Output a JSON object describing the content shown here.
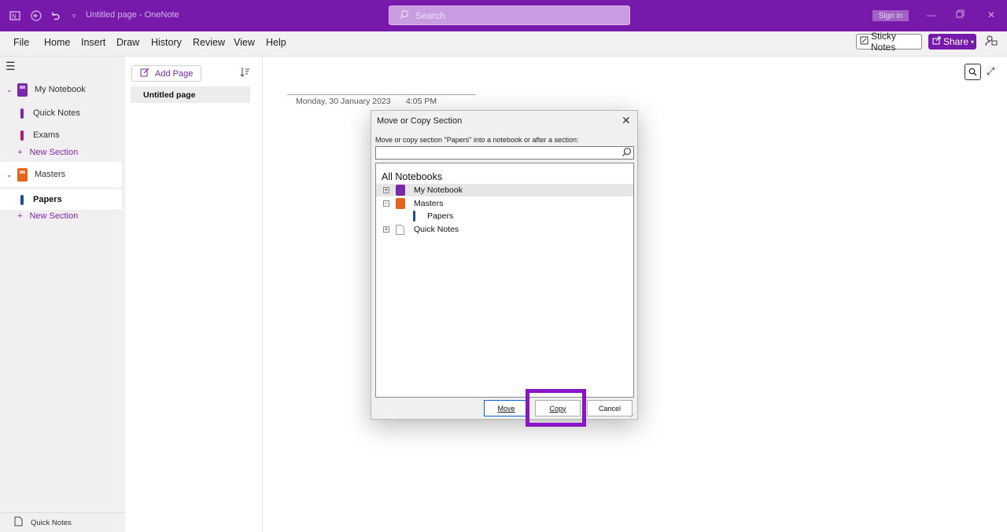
{
  "titlebar": {
    "title": "Untitled page - OneNote",
    "search_placeholder": "Search",
    "signin_label": "Sign in"
  },
  "menu": {
    "items": [
      "File",
      "Home",
      "Insert",
      "Draw",
      "History",
      "Review",
      "View",
      "Help"
    ],
    "sticky_notes_label": "Sticky Notes",
    "share_label": "Share"
  },
  "nav": {
    "notebooks": [
      {
        "name": "My Notebook",
        "color": "#7a2aa8",
        "sections": [
          {
            "name": "Quick Notes",
            "color": "#7a2aa8"
          },
          {
            "name": "Exams",
            "color": "#b0197a"
          }
        ],
        "new_section": "New Section"
      },
      {
        "name": "Masters",
        "color": "#e4641b",
        "sections": [
          {
            "name": "Papers",
            "color": "#1f4e9e"
          }
        ],
        "new_section": "New Section"
      }
    ],
    "footer_label": "Quick Notes"
  },
  "pagelist": {
    "add_page_label": "Add Page",
    "pages": [
      "Untitled page"
    ]
  },
  "canvas": {
    "date": "Monday, 30 January 2023",
    "time": "4:05 PM"
  },
  "dialog": {
    "title": "Move or Copy Section",
    "prompt": "Move or copy section \"Papers\" into a notebook or after a section:",
    "tree_root": "All Notebooks",
    "tree": [
      {
        "label": "My Notebook",
        "expander": "⊞"
      },
      {
        "label": "Masters",
        "expander": "⊟"
      },
      {
        "label": "Papers"
      },
      {
        "label": "Quick Notes",
        "expander": "⊞"
      }
    ],
    "buttons": {
      "move": "Move",
      "copy": "Copy",
      "cancel": "Cancel"
    }
  },
  "colors": {
    "brand": "#7719aa",
    "highlight": "#8b14c9"
  }
}
